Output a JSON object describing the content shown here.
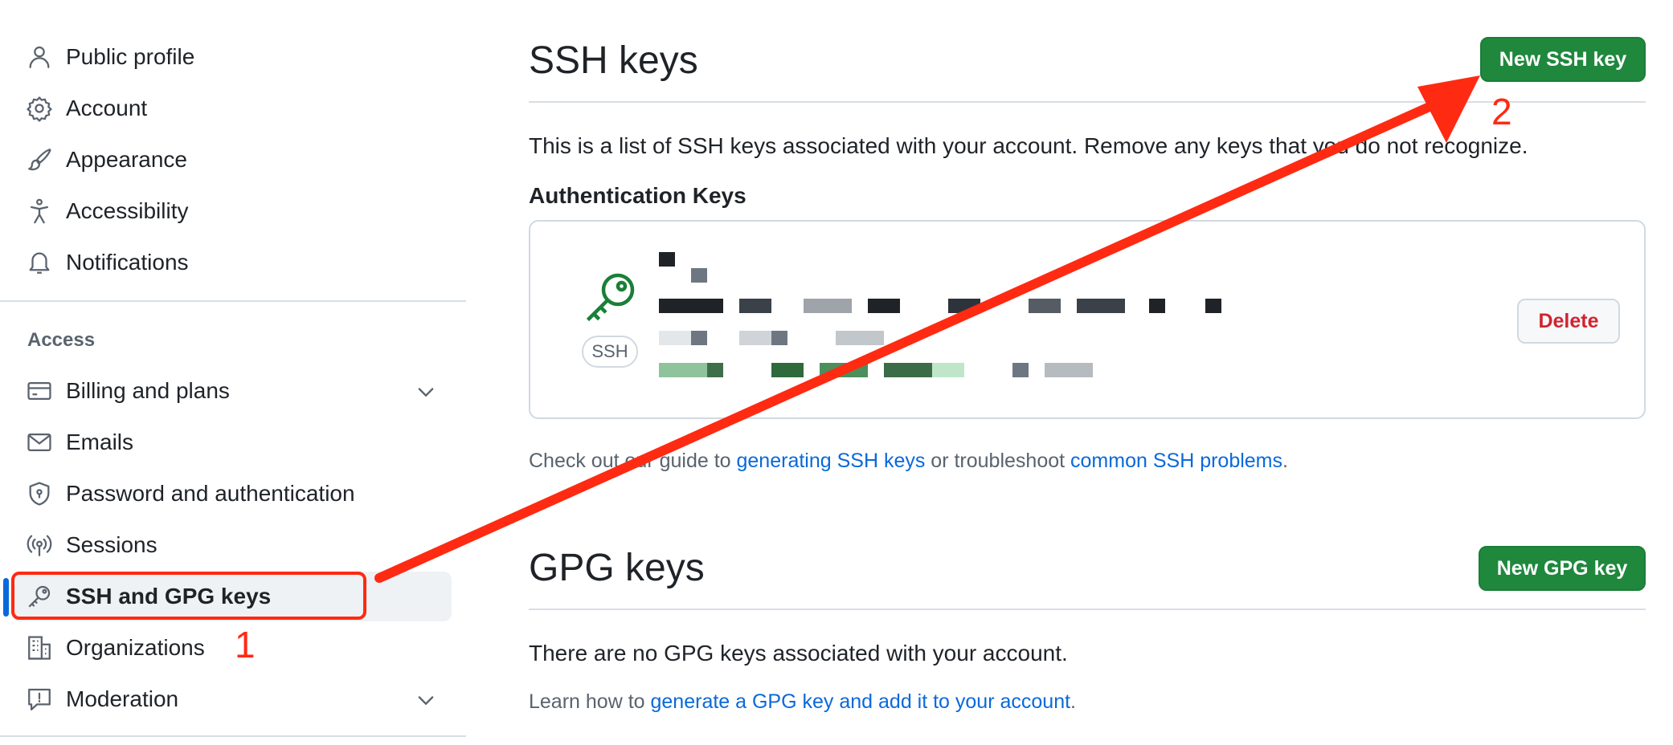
{
  "sidebar": {
    "items": [
      {
        "label": "Public profile",
        "icon": "person-icon"
      },
      {
        "label": "Account",
        "icon": "gear-icon"
      },
      {
        "label": "Appearance",
        "icon": "paintbrush-icon"
      },
      {
        "label": "Accessibility",
        "icon": "accessibility-icon"
      },
      {
        "label": "Notifications",
        "icon": "bell-icon"
      }
    ],
    "access_heading": "Access",
    "access_items": [
      {
        "label": "Billing and plans",
        "icon": "credit-card-icon",
        "expandable": true
      },
      {
        "label": "Emails",
        "icon": "mail-icon"
      },
      {
        "label": "Password and authentication",
        "icon": "shield-lock-icon"
      },
      {
        "label": "Sessions",
        "icon": "broadcast-icon"
      },
      {
        "label": "SSH and GPG keys",
        "icon": "key-icon",
        "active": true
      },
      {
        "label": "Organizations",
        "icon": "organization-icon"
      },
      {
        "label": "Moderation",
        "icon": "report-icon",
        "expandable": true
      }
    ]
  },
  "ssh": {
    "title": "SSH keys",
    "new_button": "New SSH key",
    "description": "This is a list of SSH keys associated with your account. Remove any keys that you do not recognize.",
    "auth_heading": "Authentication Keys",
    "key_badge": "SSH",
    "delete_button": "Delete",
    "help_prefix": "Check out our guide to ",
    "help_link1": "generating SSH keys",
    "help_middle": " or troubleshoot ",
    "help_link2": "common SSH problems",
    "help_suffix": "."
  },
  "gpg": {
    "title": "GPG keys",
    "new_button": "New GPG key",
    "empty_text": "There are no GPG keys associated with your account.",
    "learn_prefix": "Learn how to ",
    "learn_link": "generate a GPG key and add it to your account",
    "learn_suffix": "."
  },
  "annotations": {
    "step1": "1",
    "step2": "2",
    "color": "#ff2a12"
  },
  "colors": {
    "accent_green": "#1f883d",
    "link_blue": "#0969da",
    "danger_red": "#d1242f",
    "active_indicator": "#0969da"
  }
}
